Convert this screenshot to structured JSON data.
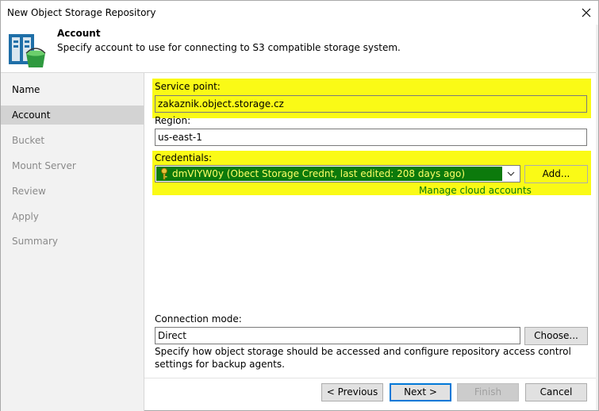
{
  "window": {
    "title": "New Object Storage Repository"
  },
  "header": {
    "title": "Account",
    "description": "Specify account to use for connecting to S3 compatible storage system.",
    "icon": "object-storage-repository-icon"
  },
  "sidebar": {
    "items": [
      {
        "label": "Name",
        "state": "done"
      },
      {
        "label": "Account",
        "state": "active"
      },
      {
        "label": "Bucket",
        "state": "pending"
      },
      {
        "label": "Mount Server",
        "state": "pending"
      },
      {
        "label": "Review",
        "state": "pending"
      },
      {
        "label": "Apply",
        "state": "pending"
      },
      {
        "label": "Summary",
        "state": "pending"
      }
    ]
  },
  "form": {
    "service_point_label": "Service point:",
    "service_point_value": "zakaznik.object.storage.cz",
    "region_label": "Region:",
    "region_value": "us-east-1",
    "credentials_label": "Credentials:",
    "credentials_value": "dmVIYW0y (Obect Storage Crednt, last edited: 208 days ago)",
    "add_button": "Add...",
    "manage_link": "Manage cloud accounts",
    "connection_mode_label": "Connection mode:",
    "connection_mode_value": "Direct",
    "choose_button": "Choose...",
    "connection_mode_help": "Specify how object storage should be accessed and configure repository access control settings for backup agents."
  },
  "footer": {
    "previous": "< Previous",
    "next": "Next >",
    "finish": "Finish",
    "cancel": "Cancel"
  },
  "colors": {
    "highlight": "#fafa16",
    "selection_bg": "#0c7a0c",
    "selection_text": "#ffff66",
    "link": "#0b7a0b",
    "active_step_bg": "#d3d3d3",
    "sidebar_bg": "#f2f2f2"
  }
}
